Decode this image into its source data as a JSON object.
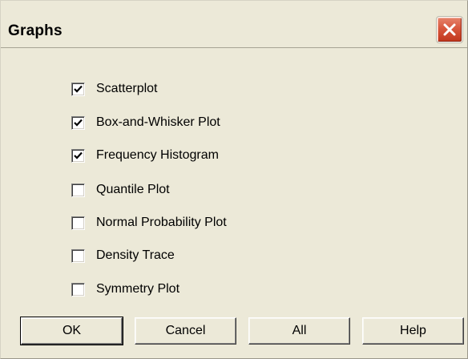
{
  "window": {
    "title": "Graphs",
    "close_icon": "close-icon"
  },
  "options": [
    {
      "label": "Scatterplot",
      "checked": true
    },
    {
      "label": "Box-and-Whisker Plot",
      "checked": true
    },
    {
      "label": "Frequency Histogram",
      "checked": true
    },
    {
      "label": "Quantile Plot",
      "checked": false
    },
    {
      "label": "Normal Probability Plot",
      "checked": false
    },
    {
      "label": "Density Trace",
      "checked": false
    },
    {
      "label": "Symmetry Plot",
      "checked": false
    }
  ],
  "buttons": {
    "ok": "OK",
    "cancel": "Cancel",
    "all": "All",
    "help": "Help"
  },
  "colors": {
    "face": "#ece9d8",
    "close_button": "#d8573d"
  }
}
